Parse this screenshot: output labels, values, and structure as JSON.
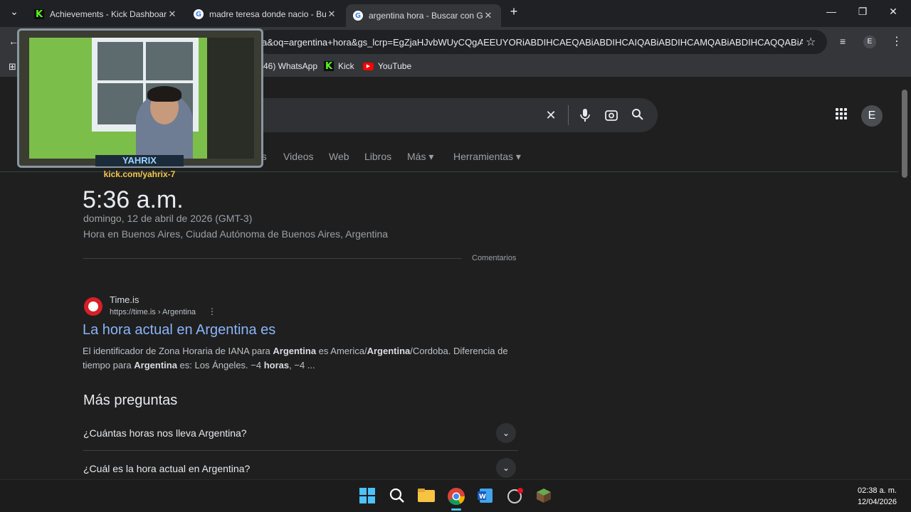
{
  "tabs": [
    {
      "title": "Achievements - Kick Dashboard",
      "favicon": "kick-icon",
      "active": false
    },
    {
      "title": "madre teresa donde nacio - Bu",
      "favicon": "google-icon",
      "active": false
    },
    {
      "title": "argentina hora - Buscar con Go",
      "favicon": "google-icon",
      "active": true
    }
  ],
  "omnibox": {
    "url": "a&oq=argentina+hora&gs_lcrp=EgZjaHJvbWUyCQgAEEUYORiABDIHCAEQABiABDIHCAIQABiABDIHCAMQABiABDIHCAQQABiAB..."
  },
  "bookmarks": [
    {
      "label": "(46) WhatsApp",
      "icon": "whatsapp-icon"
    },
    {
      "label": "Kick",
      "icon": "kick-icon"
    },
    {
      "label": "YouTube",
      "icon": "youtube-icon"
    }
  ],
  "profile": {
    "initial": "E"
  },
  "filters": [
    "es",
    "Videos",
    "Web",
    "Libros",
    "Más ▾",
    "Herramientas ▾"
  ],
  "time_card": {
    "time": "5:36 a.m.",
    "date": "domingo, 12 de abril de 2026 (GMT-3)",
    "place": "Hora en Buenos Aires, Ciudad Autónoma de Buenos Aires, Argentina",
    "feedback": "Comentarios"
  },
  "result": {
    "site": "Time.is",
    "url": "https://time.is › Argentina",
    "title": "La hora actual en Argentina es",
    "snippet_parts": [
      "El identificador de Zona Horaria de IANA para ",
      "Argentina",
      " es America/",
      "Argentina",
      "/Cordoba. Diferencia de tiempo para ",
      "Argentina",
      " es: Los Ángeles. −4 ",
      "horas",
      ", −4 ..."
    ]
  },
  "paa": {
    "title": "Más preguntas",
    "questions": [
      "¿Cuántas horas nos lleva Argentina?",
      "¿Cuál es la hora actual en Argentina?"
    ]
  },
  "overlay": {
    "name": "YAHRIX",
    "link": "kick.com/yahrix-7"
  },
  "clock": {
    "time": "02:38 a. m.",
    "date": "12/04/2026"
  },
  "colors": {
    "link": "#8ab4f8",
    "kick_green": "#53fc18",
    "bg": "#1f1f1f"
  }
}
